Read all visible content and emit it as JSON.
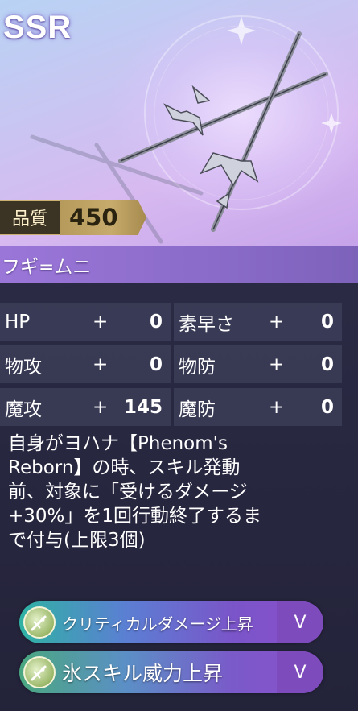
{
  "card": {
    "rarity": "SSR",
    "quality_label": "品質",
    "quality_value": "450",
    "name": "フギ=ムニ"
  },
  "stats": [
    {
      "name": "HP",
      "sign": "+",
      "value": "0"
    },
    {
      "name": "素早さ",
      "sign": "+",
      "value": "0"
    },
    {
      "name": "物攻",
      "sign": "+",
      "value": "0"
    },
    {
      "name": "物防",
      "sign": "+",
      "value": "0"
    },
    {
      "name": "魔攻",
      "sign": "+",
      "value": "145"
    },
    {
      "name": "魔防",
      "sign": "+",
      "value": "0"
    }
  ],
  "description": "自身がヨハナ【Phenom's\nReborn】の時、スキル発動\n前、対象に「受けるダメージ\n+30%」を1回行動終了するま\nで付与(上限3個)",
  "skills": [
    {
      "label": "クリティカルダメージ上昇",
      "level": "V",
      "icon": "spear-emblem-icon"
    },
    {
      "label": "氷スキル威力上昇",
      "level": "V",
      "icon": "spear-emblem-icon"
    }
  ],
  "colors": {
    "accent_purple": "#9a76d8",
    "quality_gold": "#c6ab6c",
    "skill_teal": "#2fb2a3"
  }
}
